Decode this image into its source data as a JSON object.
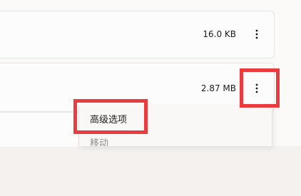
{
  "files": [
    {
      "size": "16.0 KB",
      "more_icon": "more-vertical-icon"
    },
    {
      "size": "2.87 MB",
      "more_icon": "more-vertical-icon"
    }
  ],
  "context_menu": {
    "items": [
      {
        "label": "高级选项",
        "state": "enabled"
      },
      {
        "label": "移动",
        "state": "disabled"
      }
    ]
  },
  "annotations": {
    "highlight_color": "#ea3b3e"
  },
  "colors": {
    "background": "#f5f1ee",
    "row_background": "#fdfcfc",
    "disabled_text": "#8e8b89"
  }
}
